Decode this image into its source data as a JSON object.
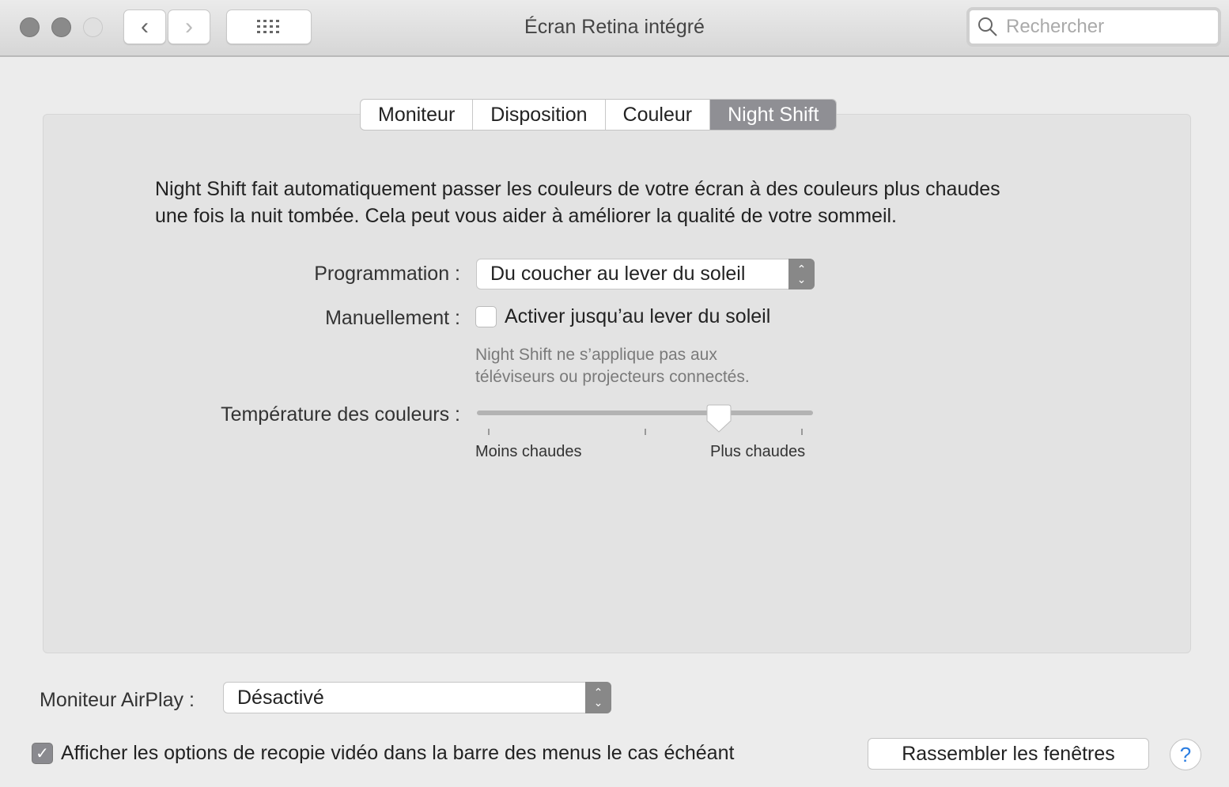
{
  "window": {
    "title": "Écran Retina intégré",
    "search_placeholder": "Rechercher"
  },
  "tabs": [
    {
      "label": "Moniteur"
    },
    {
      "label": "Disposition"
    },
    {
      "label": "Couleur"
    },
    {
      "label": "Night Shift",
      "selected": true
    }
  ],
  "night_shift": {
    "description_line1": "Night Shift fait automatiquement passer les couleurs de votre écran à des couleurs plus chaudes",
    "description_line2": "une fois la nuit tombée. Cela peut vous aider à améliorer la qualité de votre sommeil.",
    "schedule_label": "Programmation :",
    "schedule_value": "Du coucher au lever du soleil",
    "manual_label": "Manuellement :",
    "manual_checkbox_label": "Activer jusqu’au lever du soleil",
    "manual_checked": false,
    "note_line1": "Night Shift ne s’applique pas aux",
    "note_line2": "téléviseurs ou projecteurs connectés.",
    "temperature_label": "Température des couleurs :",
    "temperature_value": 0.72,
    "min_label": "Moins chaudes",
    "max_label": "Plus chaudes"
  },
  "airplay": {
    "label": "Moniteur AirPlay :",
    "value": "Désactivé"
  },
  "mirroring": {
    "label": "Afficher les options de recopie vidéo dans la barre des menus le cas échéant",
    "checked": true
  },
  "gather_button": "Rassembler les fenêtres",
  "help": "?"
}
